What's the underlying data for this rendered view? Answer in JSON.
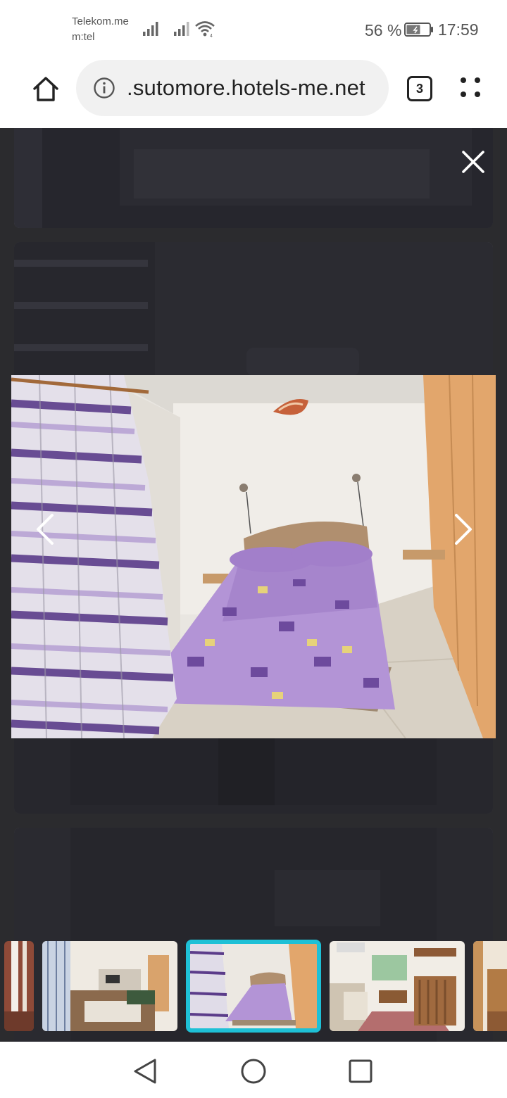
{
  "status_bar": {
    "carrier_line1": "Telekom.me",
    "carrier_line2": "m:tel",
    "battery": "56 %",
    "time": "17:59"
  },
  "browser": {
    "url": ".sutomore.hotels-me.net",
    "tab_count": "3"
  },
  "gallery": {
    "selected_index": 3,
    "thumbnails": [
      {
        "name": "partial-room"
      },
      {
        "name": "apartment-living-room"
      },
      {
        "name": "bedroom-purple-bed"
      },
      {
        "name": "studio-with-table"
      },
      {
        "name": "partial-kitchen"
      }
    ],
    "accent_color": "#1ec0d6"
  }
}
